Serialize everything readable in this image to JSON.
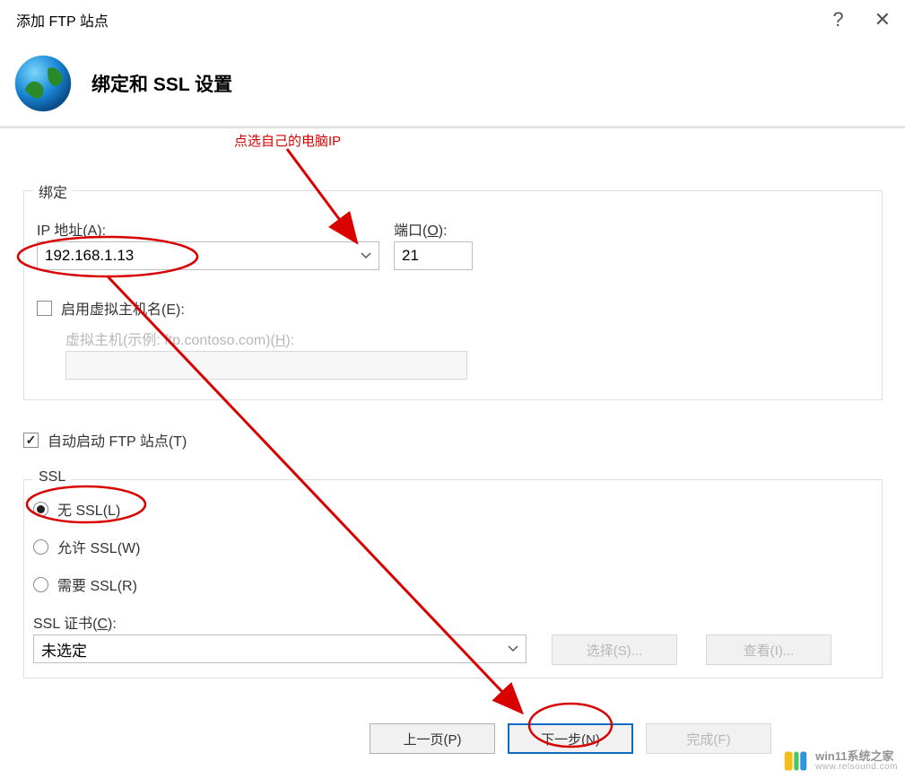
{
  "window": {
    "title": "添加 FTP 站点",
    "help_symbol": "?",
    "close_symbol": "✕"
  },
  "header": {
    "title": "绑定和 SSL 设置"
  },
  "annotation": {
    "tip_top": "点选自己的电脑IP"
  },
  "binding": {
    "legend": "绑定",
    "ip_label_pre": "IP 地址(",
    "ip_label_ul": "A",
    "ip_label_post": "):",
    "ip_value": "192.168.1.13",
    "port_label_pre": "端口(",
    "port_label_ul": "O",
    "port_label_post": "):",
    "port_value": "21",
    "vhost_enable_pre": "启用虚拟主机名(",
    "vhost_enable_ul": "E",
    "vhost_enable_post": "):",
    "vhost_hint_pre": "虚拟主机(示例: ftp.contoso.com)(",
    "vhost_hint_ul": "H",
    "vhost_hint_post": "):"
  },
  "autostart": {
    "label_pre": "自动启动 FTP 站点(",
    "label_ul": "T",
    "label_post": ")"
  },
  "ssl": {
    "legend": "SSL",
    "no_ssl_pre": "无 SSL(",
    "no_ssl_ul": "L",
    "no_ssl_post": ")",
    "allow_ssl_pre": "允许 SSL(",
    "allow_ssl_ul": "W",
    "allow_ssl_post": ")",
    "require_ssl_pre": "需要 SSL(",
    "require_ssl_ul": "R",
    "require_ssl_post": ")",
    "cert_label_pre": "SSL 证书(",
    "cert_label_ul": "C",
    "cert_label_post": "):",
    "cert_value": "未选定",
    "select_btn_pre": "选择(",
    "select_btn_ul": "S",
    "select_btn_post": ")...",
    "view_btn_pre": "查看(",
    "view_btn_ul": "I",
    "view_btn_post": ")..."
  },
  "footer": {
    "prev_pre": "上一页(",
    "prev_ul": "P",
    "prev_post": ")",
    "next_pre": "下一步(",
    "next_ul": "N",
    "next_post": ")",
    "finish_pre": "完成(",
    "finish_ul": "F",
    "finish_post": ")"
  },
  "watermark": {
    "line1": "win11系统之家",
    "line2": "www.relsound.com"
  }
}
